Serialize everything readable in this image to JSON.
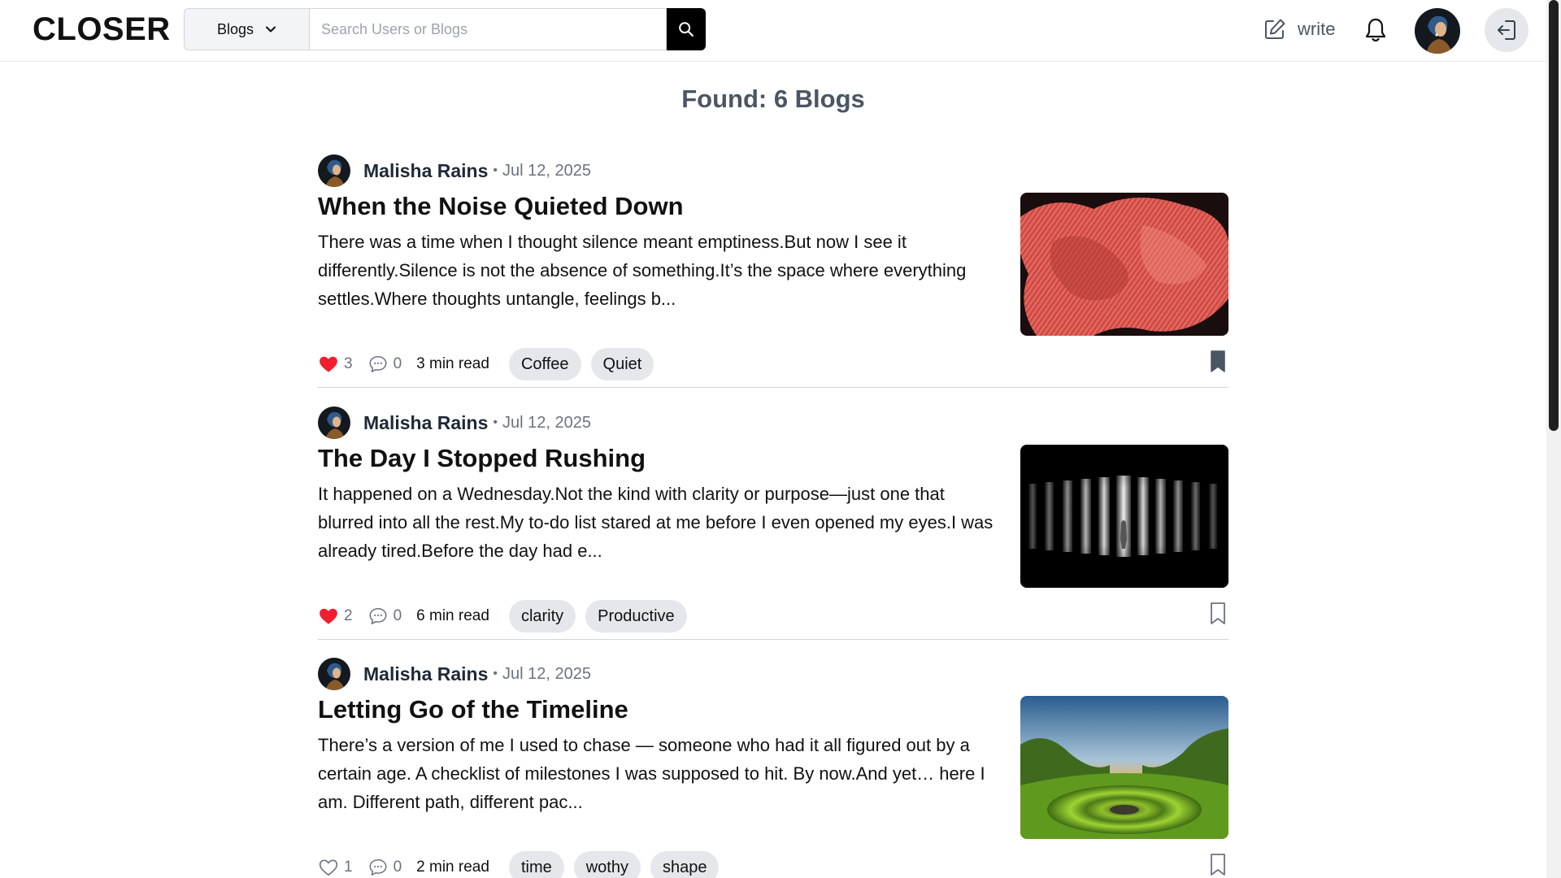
{
  "header": {
    "logo": "CLOSER",
    "search_type": "Blogs",
    "search_placeholder": "Search Users or Blogs",
    "search_value": "",
    "write_label": "write"
  },
  "results": {
    "found_label": "Found: 6 Blogs"
  },
  "posts": [
    {
      "author": "Malisha Rains",
      "date": "Jul 12, 2025",
      "title": "When the Noise Quieted Down",
      "excerpt": "There was a time when I thought silence meant emptiness.But now I see it differently.Silence is not the absence of something.It’s the space where everything settles.Where thoughts untangle, feelings b...",
      "likes": "3",
      "liked": true,
      "comments": "0",
      "read_time": "3 min read",
      "tags": [
        "Coffee",
        "Quiet"
      ],
      "bookmarked": true,
      "thumbnail": "red-fabric-image"
    },
    {
      "author": "Malisha Rains",
      "date": "Jul 12, 2025",
      "title": "The Day I Stopped Rushing",
      "excerpt": "It happened on a Wednesday.Not the kind with clarity or purpose—just one that blurred into all the rest.My to-do list stared at me before I even opened my eyes.I was already tired.Before the day had e...",
      "likes": "2",
      "liked": true,
      "comments": "0",
      "read_time": "6 min read",
      "tags": [
        "clarity",
        "Productive"
      ],
      "bookmarked": false,
      "thumbnail": "dark-corridor-image"
    },
    {
      "author": "Malisha Rains",
      "date": "Jul 12, 2025",
      "title": "Letting Go of the Timeline",
      "excerpt": "There’s a version of me I used to chase — someone who had it all figured out by a certain age. A checklist of milestones I was supposed to hit. By now.And yet… here I am. Different path, different pac...",
      "likes": "1",
      "liked": false,
      "comments": "0",
      "read_time": "2 min read",
      "tags": [
        "time",
        "wothy",
        "shape"
      ],
      "bookmarked": false,
      "thumbnail": "green-valley-image"
    }
  ],
  "colors": {
    "like_red": "#ef1f2f",
    "tag_bg": "#e5e7eb",
    "muted_text": "#6b7280"
  }
}
